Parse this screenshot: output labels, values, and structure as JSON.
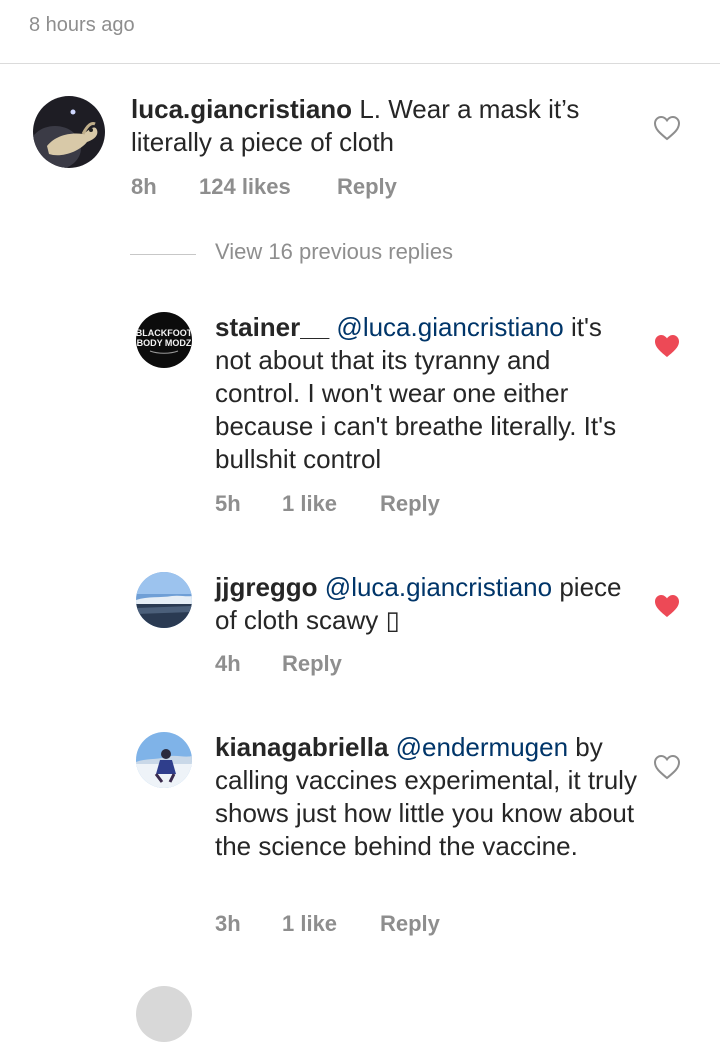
{
  "header": {
    "timestamp": "8 hours ago"
  },
  "view_replies_label": "View 16 previous replies",
  "comments": [
    {
      "username": "luca.giancristiano",
      "mention": "",
      "text": "L. Wear a mask it’s literally a piece of cloth",
      "time": "8h",
      "likes": "124 likes",
      "reply": "Reply",
      "liked": false,
      "avatar_icon": "dog-photo-avatar"
    },
    {
      "username": "stainer__",
      "mention": "@luca.giancristiano",
      "text": "it's not about that its tyranny and control.  I won't wear one either because i can't breathe literally. It's bullshit control",
      "time": "5h",
      "likes": "1 like",
      "reply": "Reply",
      "liked": true,
      "avatar_icon": "blackfoot-body-modz-logo-avatar",
      "avatar_text_1": "BLACKFOOT",
      "avatar_text_2": "BODY MODZ"
    },
    {
      "username": "jjgreggo",
      "mention": "@luca.giancristiano",
      "text": "piece of cloth scawy ▯",
      "time": "4h",
      "likes": "",
      "reply": "Reply",
      "liked": true,
      "avatar_icon": "landscape-photo-avatar"
    },
    {
      "username": "kianagabriella",
      "mention": "@endermugen",
      "text": "by calling vaccines experimental, it truly shows just how little you know about the science behind the vaccine.",
      "time": "3h",
      "likes": "1 like",
      "reply": "Reply",
      "liked": false,
      "avatar_icon": "person-photo-avatar"
    }
  ],
  "colors": {
    "liked_heart": "#ed4956",
    "muted": "#8e8e8e",
    "mention": "#003569"
  }
}
